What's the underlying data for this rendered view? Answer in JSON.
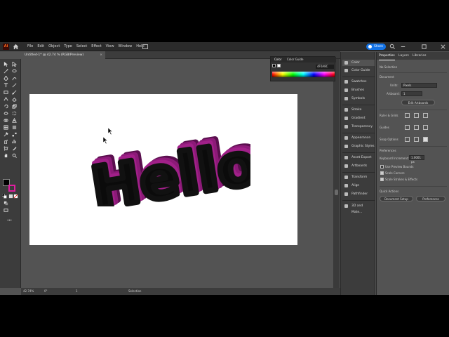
{
  "app": {
    "logo": "Ai"
  },
  "menu": [
    "File",
    "Edit",
    "Object",
    "Type",
    "Select",
    "Effect",
    "View",
    "Window",
    "Help"
  ],
  "share_label": "Share",
  "document_tab": {
    "title": "Untitled-1* @ 42.74 % (RGB/Preview)",
    "close": "×"
  },
  "artwork_text": "Hello",
  "color_panel": {
    "tabs": [
      "Color",
      "Color Guide"
    ],
    "hex": "4F0A8C"
  },
  "panel_strip": {
    "groups": [
      [
        "Color",
        "Color Guide"
      ],
      [
        "Swatches",
        "Brushes",
        "Symbols"
      ],
      [
        "Stroke",
        "Gradient",
        "Transparency"
      ],
      [
        "Appearance",
        "Graphic Styles"
      ],
      [
        "Asset Export",
        "Artboards"
      ],
      [
        "Transform",
        "Align",
        "Pathfinder"
      ],
      [
        "3D and Mate..."
      ]
    ]
  },
  "properties": {
    "tabs": [
      "Properties",
      "Layers",
      "Libraries"
    ],
    "no_selection": "No Selection",
    "document_label": "Document",
    "units_label": "Units:",
    "units_value": "Pixels",
    "artboard_label": "Artboard:",
    "artboard_value": "1",
    "edit_artboards": "Edit Artboards",
    "ruler_grids": "Ruler & Grids",
    "guides": "Guides",
    "snap_options": "Snap Options",
    "preferences_label": "Preferences",
    "keyboard_increment_label": "Keyboard Increment:",
    "keyboard_increment_value": "1.0001 px",
    "use_preview_bounds": "Use Preview Bounds",
    "scale_corners": "Scale Corners",
    "scale_strokes": "Scale Strokes & Effects",
    "quick_actions": "Quick Actions",
    "document_setup": "Document Setup",
    "preferences_button": "Preferences"
  },
  "status": {
    "zoom": "42.74%",
    "rotate": "0°",
    "artboard": "1",
    "tool": "Selection"
  },
  "colors": {
    "fill": "#000000",
    "stroke": "#e11da0",
    "extrude": "#7a1466",
    "accent": "#1473e6"
  }
}
